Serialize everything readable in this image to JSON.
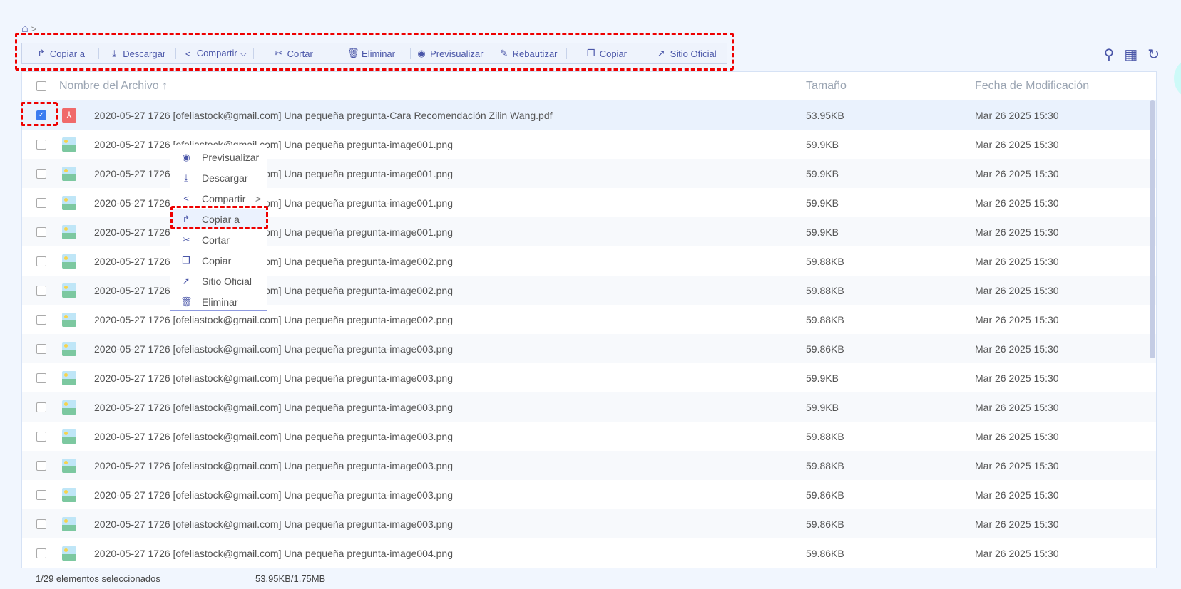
{
  "breadcrumb": {
    "home_icon": "home-icon",
    "sep": ">"
  },
  "toolbar": [
    {
      "label": "Copiar a",
      "icon": "↱",
      "w": 108
    },
    {
      "label": "Descargar",
      "icon": "⤓",
      "w": 108
    },
    {
      "label": "Compartir ⌵",
      "icon": "<",
      "w": 110
    },
    {
      "label": "Cortar",
      "icon": "✂",
      "w": 110
    },
    {
      "label": "Eliminar",
      "icon": "🗑",
      "w": 110
    },
    {
      "label": "Previsualizar",
      "icon": "◉",
      "w": 110
    },
    {
      "label": "Rebautizar",
      "icon": "✎",
      "w": 110
    },
    {
      "label": "Copiar",
      "icon": "❐",
      "w": 110
    },
    {
      "label": "Sitio Oficial",
      "icon": "➚",
      "w": 114
    }
  ],
  "headers": {
    "name": "Nombre del Archivo ↑",
    "size": "Tamaño",
    "date": "Fecha de Modificación"
  },
  "rows": [
    {
      "name": "2020-05-27 1726 [ofeliastock@gmail.com] Una pequeña pregunta-Cara Recomendación Zilin Wang.pdf",
      "size": "53.95KB",
      "date": "Mar 26 2025 15:30",
      "type": "pdf",
      "checked": true
    },
    {
      "name": "2020-05-27 1726 [ofeliastock@gmail.com] Una pequeña pregunta-image001.png",
      "size": "59.9KB",
      "date": "Mar 26 2025 15:30",
      "type": "img"
    },
    {
      "name": "2020-05-27 1726 [ofeliastock@gmail.com] Una pequeña pregunta-image001.png",
      "size": "59.9KB",
      "date": "Mar 26 2025 15:30",
      "type": "img"
    },
    {
      "name": "2020-05-27 1726 [ofeliastock@gmail.com] Una pequeña pregunta-image001.png",
      "size": "59.9KB",
      "date": "Mar 26 2025 15:30",
      "type": "img"
    },
    {
      "name": "2020-05-27 1726 [ofeliastock@gmail.com] Una pequeña pregunta-image001.png",
      "size": "59.9KB",
      "date": "Mar 26 2025 15:30",
      "type": "img"
    },
    {
      "name": "2020-05-27 1726 [ofeliastock@gmail.com] Una pequeña pregunta-image002.png",
      "size": "59.88KB",
      "date": "Mar 26 2025 15:30",
      "type": "img"
    },
    {
      "name": "2020-05-27 1726 [ofeliastock@gmail.com] Una pequeña pregunta-image002.png",
      "size": "59.88KB",
      "date": "Mar 26 2025 15:30",
      "type": "img"
    },
    {
      "name": "2020-05-27 1726 [ofeliastock@gmail.com] Una pequeña pregunta-image002.png",
      "size": "59.88KB",
      "date": "Mar 26 2025 15:30",
      "type": "img"
    },
    {
      "name": "2020-05-27 1726 [ofeliastock@gmail.com] Una pequeña pregunta-image003.png",
      "size": "59.86KB",
      "date": "Mar 26 2025 15:30",
      "type": "img"
    },
    {
      "name": "2020-05-27 1726 [ofeliastock@gmail.com] Una pequeña pregunta-image003.png",
      "size": "59.9KB",
      "date": "Mar 26 2025 15:30",
      "type": "img"
    },
    {
      "name": "2020-05-27 1726 [ofeliastock@gmail.com] Una pequeña pregunta-image003.png",
      "size": "59.9KB",
      "date": "Mar 26 2025 15:30",
      "type": "img"
    },
    {
      "name": "2020-05-27 1726 [ofeliastock@gmail.com] Una pequeña pregunta-image003.png",
      "size": "59.88KB",
      "date": "Mar 26 2025 15:30",
      "type": "img"
    },
    {
      "name": "2020-05-27 1726 [ofeliastock@gmail.com] Una pequeña pregunta-image003.png",
      "size": "59.88KB",
      "date": "Mar 26 2025 15:30",
      "type": "img"
    },
    {
      "name": "2020-05-27 1726 [ofeliastock@gmail.com] Una pequeña pregunta-image003.png",
      "size": "59.86KB",
      "date": "Mar 26 2025 15:30",
      "type": "img"
    },
    {
      "name": "2020-05-27 1726 [ofeliastock@gmail.com] Una pequeña pregunta-image003.png",
      "size": "59.86KB",
      "date": "Mar 26 2025 15:30",
      "type": "img"
    },
    {
      "name": "2020-05-27 1726 [ofeliastock@gmail.com] Una pequeña pregunta-image004.png",
      "size": "59.86KB",
      "date": "Mar 26 2025 15:30",
      "type": "img"
    }
  ],
  "context_menu": [
    {
      "label": "Previsualizar",
      "icon": "◉"
    },
    {
      "label": "Descargar",
      "icon": "⤓"
    },
    {
      "label": "Compartir",
      "icon": "<",
      "submenu": ">"
    },
    {
      "label": "Copiar a",
      "icon": "↱",
      "highlighted": true
    },
    {
      "label": "Cortar",
      "icon": "✂"
    },
    {
      "label": "Copiar",
      "icon": "❐"
    },
    {
      "label": "Sitio Oficial",
      "icon": "➚"
    },
    {
      "label": "Eliminar",
      "icon": "🗑"
    }
  ],
  "status": {
    "selected": "1/29 elementos seleccionados",
    "size": "53.95KB/1.75MB"
  },
  "colors": {
    "accent": "#4a56a8",
    "highlight": "#e00000",
    "checkbox": "#3a7cf0"
  }
}
